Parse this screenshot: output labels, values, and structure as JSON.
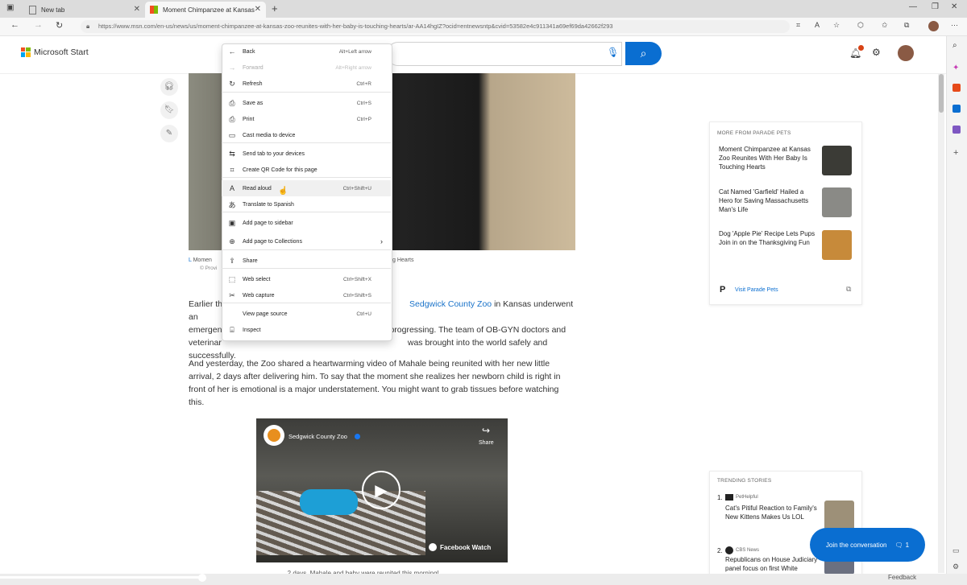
{
  "browser": {
    "tabs": [
      {
        "title": "New tab"
      },
      {
        "title": "Moment Chimpanzee at Kansas"
      }
    ],
    "address": "https://www.msn.com/en-us/news/us/moment-chimpanzee-at-kansas-zoo-reunites-with-her-baby-is-touching-hearts/ar-AA14hgIZ?ocid=entnewsntp&cvid=53582e4c911341a69ef69da42662f293"
  },
  "header": {
    "brand": "Microsoft Start"
  },
  "context_menu": {
    "items": [
      {
        "label": "Back",
        "shortcut": "Alt+Left arrow",
        "icon": "back-arrow-icon"
      },
      {
        "label": "Forward",
        "shortcut": "Alt+Right arrow",
        "icon": "forward-arrow-icon",
        "disabled": true
      },
      {
        "label": "Refresh",
        "shortcut": "Ctrl+R",
        "icon": "refresh-icon"
      },
      {
        "label": "Save as",
        "shortcut": "Ctrl+S",
        "icon": "save-icon"
      },
      {
        "label": "Print",
        "shortcut": "Ctrl+P",
        "icon": "print-icon"
      },
      {
        "label": "Cast media to device",
        "shortcut": "",
        "icon": "cast-icon"
      },
      {
        "label": "Send tab to your devices",
        "shortcut": "",
        "icon": "send-tab-icon"
      },
      {
        "label": "Create QR Code for this page",
        "shortcut": "",
        "icon": "qr-code-icon"
      },
      {
        "label": "Read aloud",
        "shortcut": "Ctrl+Shift+U",
        "icon": "read-aloud-icon",
        "hover": true
      },
      {
        "label": "Translate to Spanish",
        "shortcut": "",
        "icon": "translate-icon"
      },
      {
        "label": "Add page to sidebar",
        "shortcut": "",
        "icon": "sidebar-icon"
      },
      {
        "label": "Add page to Collections",
        "shortcut": "",
        "icon": "collections-icon",
        "submenu": true
      },
      {
        "label": "Share",
        "shortcut": "",
        "icon": "share-icon"
      },
      {
        "label": "Web select",
        "shortcut": "Ctrl+Shift+X",
        "icon": "web-select-icon"
      },
      {
        "label": "Web capture",
        "shortcut": "Ctrl+Shift+S",
        "icon": "web-capture-icon"
      },
      {
        "label": "View page source",
        "shortcut": "Ctrl+U",
        "icon": ""
      },
      {
        "label": "Inspect",
        "shortcut": "",
        "icon": "inspect-icon"
      }
    ]
  },
  "article": {
    "caption_left": "Momen",
    "caption_right": "g Hearts",
    "caption_sub": "© Provi",
    "para1_start": "Earlier th",
    "para1_link": "Sedgwick County Zoo",
    "para1_after_link": " in Kansas underwent an",
    "para1_line2_left": "emergen",
    "para1_line2_right": "progressing. The team of OB-GYN doctors and",
    "para1_line3_left": "veterinar",
    "para1_line3_right": "was brought into the world safely and",
    "para1_line4": "successfully.",
    "para2": "And yesterday, the Zoo shared a heartwarming video of Mahale being reunited with her new little arrival, 2 days after delivering him. To say that the moment she realizes her newborn child is right in front of her is emotional is a major understatement. You might want to grab tissues before watching this.",
    "video_channel": "Sedgwick County Zoo",
    "video_share": "Share",
    "video_brand": "Facebook Watch",
    "bottom_text": "...2 days, Mahale and baby were reunited this morning!"
  },
  "right_rail": {
    "card1_title": "MORE FROM PARADE PETS",
    "stories": [
      {
        "title": "Moment Chimpanzee at Kansas Zoo Reunites With Her Baby Is Touching Hearts",
        "color": "#3b3b36"
      },
      {
        "title": "Cat Named 'Garfield' Hailed a Hero for Saving Massachusetts Man's Life",
        "color": "#8a8a86"
      },
      {
        "title": "Dog 'Apple Pie' Recipe Lets Pups Join in on the Thanksgiving Fun",
        "color": "#c78a3a"
      }
    ],
    "visit_label": "Visit Parade Pets",
    "card2_title": "TRENDING STORIES",
    "trending": [
      {
        "num": "1.",
        "source": "PetHelpful",
        "title": "Cat's Pitiful Reaction to Family's New Kittens Makes Us LOL"
      },
      {
        "num": "2.",
        "source": "CBS News",
        "title": "Republicans on House Judiciary panel focus on first White House target"
      }
    ],
    "join_label": "Join the conversation",
    "join_count": "1",
    "feedback": "Feedback"
  },
  "colors": {
    "accent": "#0a6ed1",
    "link": "#1a73c9"
  }
}
